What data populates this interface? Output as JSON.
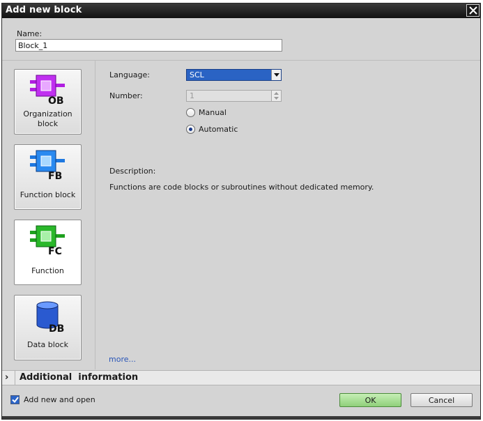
{
  "window": {
    "title": "Add new block"
  },
  "name": {
    "label": "Name:",
    "value": "Block_1"
  },
  "block_types": [
    {
      "label": "Organization block",
      "icon": "organization-block-icon",
      "badge": "OB",
      "color": "#b01ee0",
      "selected": false
    },
    {
      "label": "Function block",
      "icon": "function-block-icon",
      "badge": "FB",
      "color": "#1e78e0",
      "selected": false
    },
    {
      "label": "Function",
      "icon": "function-icon",
      "badge": "FC",
      "color": "#1ea01e",
      "selected": true
    },
    {
      "label": "Data block",
      "icon": "data-block-icon",
      "badge": "DB",
      "color": "#2a5ad0",
      "selected": false
    }
  ],
  "language": {
    "label": "Language:",
    "value": "SCL"
  },
  "number": {
    "label": "Number:",
    "value": "1"
  },
  "numbering": {
    "manual_label": "Manual",
    "automatic_label": "Automatic",
    "selected": "Automatic"
  },
  "description": {
    "label": "Description:",
    "text": "Functions are code blocks or subroutines without dedicated memory."
  },
  "more_link": "more...",
  "additional_info": {
    "label": "Additional  information"
  },
  "footer": {
    "add_new_and_open_label": "Add new and open",
    "add_new_and_open_checked": true,
    "ok_label": "OK",
    "cancel_label": "Cancel"
  }
}
